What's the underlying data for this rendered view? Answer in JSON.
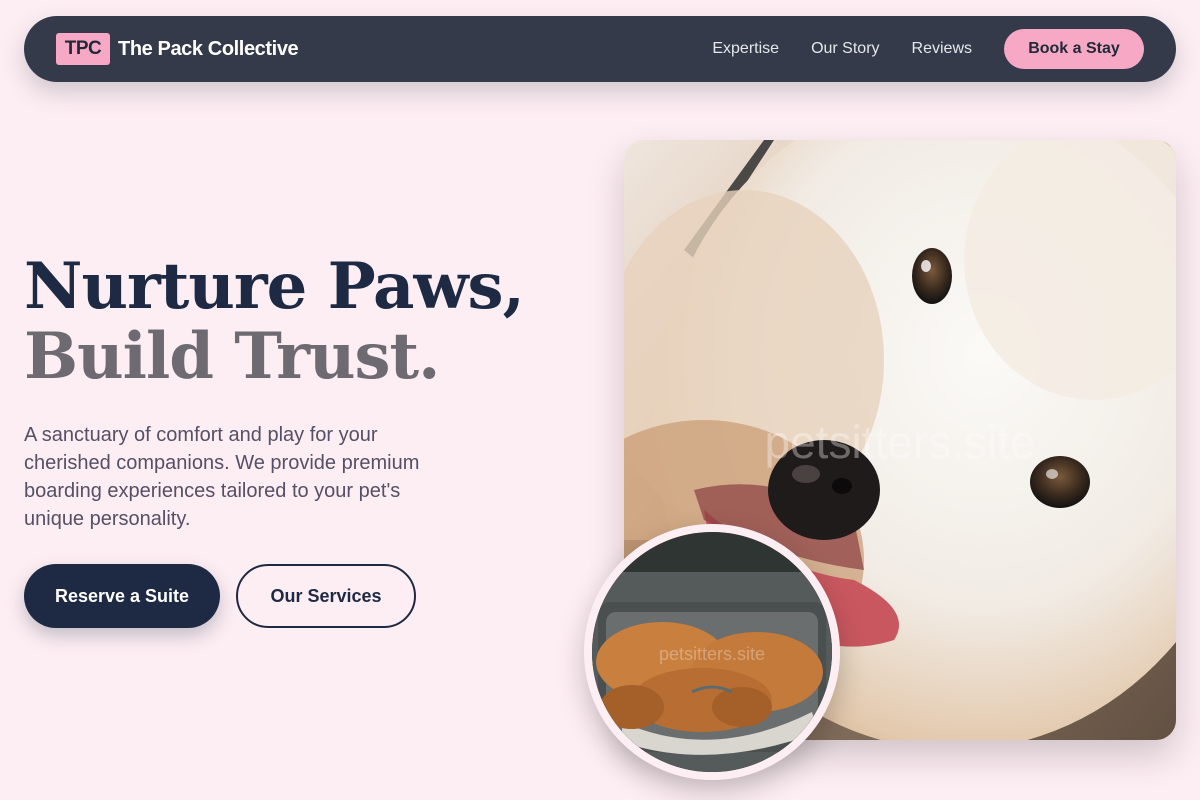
{
  "nav": {
    "logo_badge": "TPC",
    "brand_name": "The Pack Collective",
    "links": [
      "Expertise",
      "Our Story",
      "Reviews"
    ],
    "cta_label": "Book a Stay"
  },
  "hero": {
    "title_line1": "Nurture Paws,",
    "title_line2": "Build Trust.",
    "subtitle": "A sanctuary of comfort and play for your cherished companions. We provide premium boarding experiences tailored to your pet's unique personality.",
    "primary_button": "Reserve a Suite",
    "secondary_button": "Our Services"
  },
  "images": {
    "main_watermark": "petsitters.site",
    "inset_watermark": "petsitters.site"
  },
  "colors": {
    "background": "#fdeef3",
    "nav_bg": "#343a4a",
    "accent_pink": "#f7a8c4",
    "navy": "#1e2a44",
    "muted_gray": "#6e6a72"
  }
}
